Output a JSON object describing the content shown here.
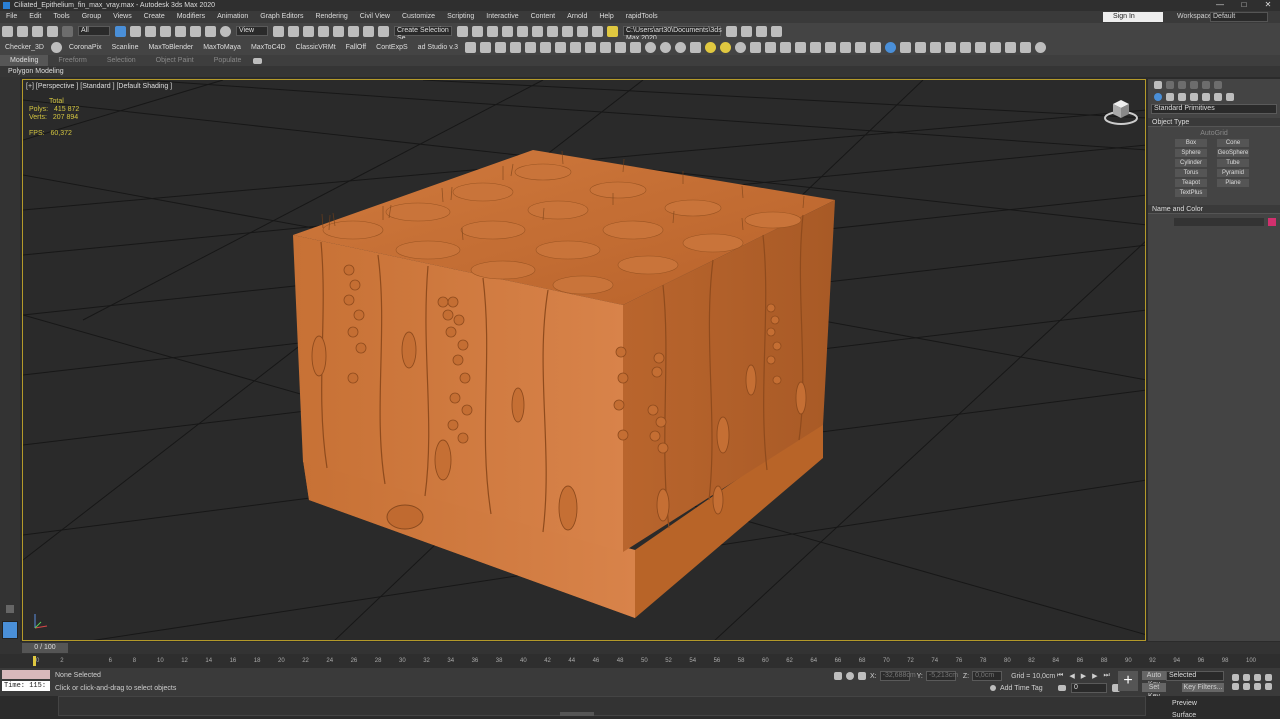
{
  "window": {
    "title": "Ciliated_Epithelium_fin_max_vray.max - Autodesk 3ds Max 2020",
    "controls": [
      "—",
      "□",
      "✕"
    ]
  },
  "menu": [
    "File",
    "Edit",
    "Tools",
    "Group",
    "Views",
    "Create",
    "Modifiers",
    "Animation",
    "Graph Editors",
    "Rendering",
    "Civil View",
    "Customize",
    "Scripting",
    "Interactive",
    "Content",
    "Arnold",
    "Help",
    "rapidTools"
  ],
  "account": {
    "signin": "Sign In",
    "workspace_label": "Workspaces:",
    "workspace_value": "Default"
  },
  "toolbar1": {
    "filter": "All",
    "ref_coord": "View",
    "selection_set": "Create Selection Se",
    "project_path": "C:\\Users\\art30\\Documents\\3ds Max 2020"
  },
  "toolbar2": {
    "items": [
      "Checker_3D",
      "CoronaPix",
      "Scanline",
      "MaxToBlender",
      "MaxToMaya",
      "MaxToC4D",
      "ClassicVRMt",
      "FallOff",
      "ContExpS",
      "ad Studio v.3"
    ]
  },
  "ribbon": {
    "tabs": [
      "Modeling",
      "Freeform",
      "Selection",
      "Object Paint",
      "Populate"
    ],
    "active": "Modeling",
    "sub": "Polygon Modeling"
  },
  "viewport": {
    "label": "[+] [Perspective ] [Standard ] [Default Shading ]",
    "stats": {
      "total": "Total",
      "polys_label": "Polys:",
      "polys": "415 872",
      "verts_label": "Verts:",
      "verts": "207 894",
      "fps_label": "FPS:",
      "fps": "60,372"
    }
  },
  "command_panel": {
    "category": "Standard Primitives",
    "object_type": "Object Type",
    "autogrid": "AutoGrid",
    "buttons": [
      "Box",
      "Cone",
      "Sphere",
      "GeoSphere",
      "Cylinder",
      "Tube",
      "Torus",
      "Pyramid",
      "Teapot",
      "Plane",
      "TextPlus"
    ],
    "name_color": "Name and Color",
    "color": "#d2306e"
  },
  "timeline": {
    "frame": "0 / 100",
    "ticks": [
      "0",
      "2",
      "6",
      "8",
      "10",
      "12",
      "14",
      "16",
      "18",
      "20",
      "22",
      "24",
      "26",
      "28",
      "30",
      "32",
      "34",
      "36",
      "38",
      "40",
      "42",
      "44",
      "46",
      "48",
      "50",
      "52",
      "54",
      "56",
      "58",
      "60",
      "62",
      "64",
      "66",
      "68",
      "70",
      "72",
      "74",
      "76",
      "78",
      "80",
      "82",
      "84",
      "86",
      "88",
      "90",
      "92",
      "94",
      "96",
      "98",
      "100"
    ]
  },
  "status": {
    "selected": "None Selected",
    "prompt": "Click or click-and-drag to select objects",
    "x_label": "X:",
    "x": "-32,688cm",
    "y_label": "Y:",
    "y": "-5,213cm",
    "z_label": "Z:",
    "z": "0,0cm",
    "grid": "Grid = 10,0cm",
    "add_time_tag": "Add Time Tag",
    "autokey": "Auto Key",
    "setkey": "Set Key",
    "key_mode": "Selected",
    "key_filters": "Key Filters...",
    "frame_field": "0",
    "time_label": "Time:",
    "time_value": "115:"
  },
  "bottom": {
    "preview": "Preview",
    "surface": "Surface"
  }
}
